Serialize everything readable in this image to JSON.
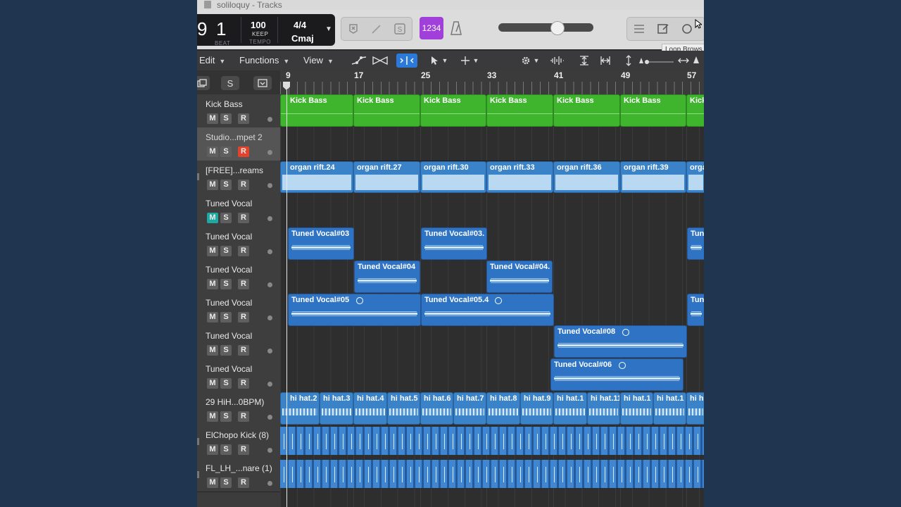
{
  "window": {
    "title": "soliloquy - Tracks"
  },
  "lcd": {
    "bar_partial": "9",
    "beat": "1",
    "beat_label": "BEAT",
    "tempo": "100",
    "tempo_mode": "KEEP",
    "tempo_label": "TEMPO",
    "time_signature": "4/4",
    "key": "Cmaj"
  },
  "control_bar": {
    "count_in_label": "1234",
    "tooltip": "Loop Brows"
  },
  "menu": {
    "edit": "Edit",
    "functions": "Functions",
    "view": "View"
  },
  "track_header_buttons": {
    "solo_label": "S"
  },
  "ruler": {
    "bars": [
      "9",
      "17",
      "25",
      "33",
      "41",
      "49",
      "57"
    ]
  },
  "buttons": {
    "m": "M",
    "s": "S",
    "r": "R"
  },
  "tracks": [
    {
      "name": "Kick Bass"
    },
    {
      "name": "Studio...mpet 2",
      "record_armed": true
    },
    {
      "name": "[FREE]...reams"
    },
    {
      "name": "Tuned Vocal",
      "muted": true
    },
    {
      "name": "Tuned Vocal"
    },
    {
      "name": "Tuned Vocal"
    },
    {
      "name": "Tuned Vocal"
    },
    {
      "name": "Tuned Vocal"
    },
    {
      "name": "Tuned Vocal"
    },
    {
      "name": "29 HiH...0BPM)"
    },
    {
      "name": "ElChopo Kick (8)"
    },
    {
      "name": "FL_LH_...nare (1)"
    }
  ],
  "regions": {
    "kick_bass": [
      "Kick Bass",
      "Kick Bass",
      "Kick Bass",
      "Kick Bass",
      "Kick Bass",
      "Kick Bass",
      "Kick"
    ],
    "organ": [
      "organ rift.24",
      "organ rift.27",
      "organ rift.30",
      "organ rift.33",
      "organ rift.36",
      "organ rift.39",
      "orga"
    ],
    "vocal_row5": [
      "Tuned Vocal#03",
      "Tuned Vocal#03.",
      "Tun"
    ],
    "vocal_row6": [
      "Tuned Vocal#04",
      "Tuned Vocal#04."
    ],
    "vocal_row7": [
      "Tuned Vocal#05",
      "Tuned Vocal#05.4",
      "Tun"
    ],
    "vocal_row8": [
      "Tuned Vocal#08"
    ],
    "vocal_row9": [
      "Tuned Vocal#06"
    ],
    "hihat": [
      "hi hat.2",
      "hi hat.3",
      "hi hat.4",
      "hi hat.5",
      "hi hat.6",
      "hi hat.7",
      "hi hat.8",
      "hi hat.9",
      "hi hat.1",
      "hi hat.11",
      "hi hat.1",
      "hi hat.1",
      "hi h"
    ]
  },
  "colors": {
    "midi_region": "#3fb52e",
    "audio_region": "#3b83c9",
    "count_in": "#a03fd9",
    "mute_on": "#1fa7a2",
    "record_on": "#e2432c"
  }
}
